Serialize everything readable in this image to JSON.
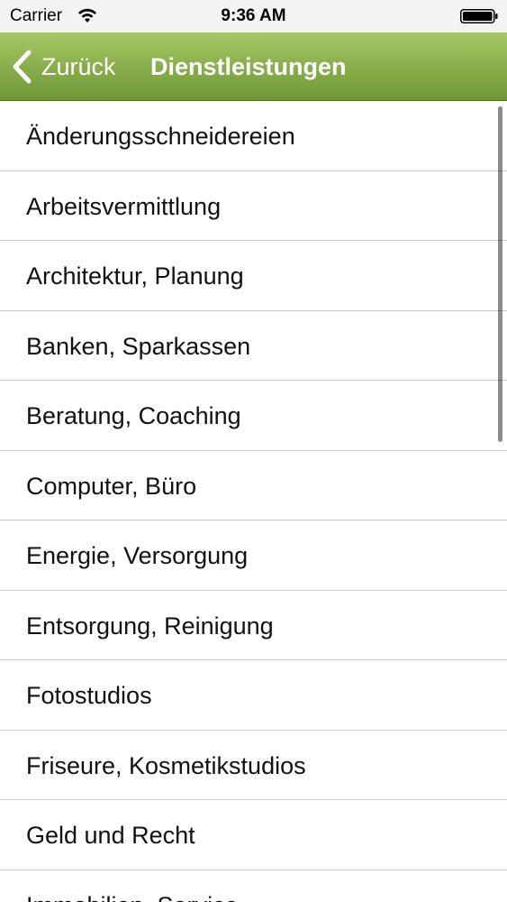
{
  "status_bar": {
    "carrier": "Carrier",
    "time": "9:36 AM",
    "wifi_icon": "wifi-icon",
    "battery_icon": "battery-icon"
  },
  "nav": {
    "back_label": "Zurück",
    "back_icon": "chevron-left-icon",
    "title": "Dienstleistungen",
    "bar_color": "#8cb24f"
  },
  "list": {
    "items": [
      {
        "label": "Änderungsschneidereien"
      },
      {
        "label": "Arbeitsvermittlung"
      },
      {
        "label": "Architektur, Planung"
      },
      {
        "label": "Banken, Sparkassen"
      },
      {
        "label": "Beratung, Coaching"
      },
      {
        "label": "Computer, Büro"
      },
      {
        "label": "Energie, Versorgung"
      },
      {
        "label": "Entsorgung, Reinigung"
      },
      {
        "label": "Fotostudios"
      },
      {
        "label": "Friseure, Kosmetikstudios"
      },
      {
        "label": "Geld und Recht"
      },
      {
        "label": "Immobilien, Service"
      }
    ]
  }
}
